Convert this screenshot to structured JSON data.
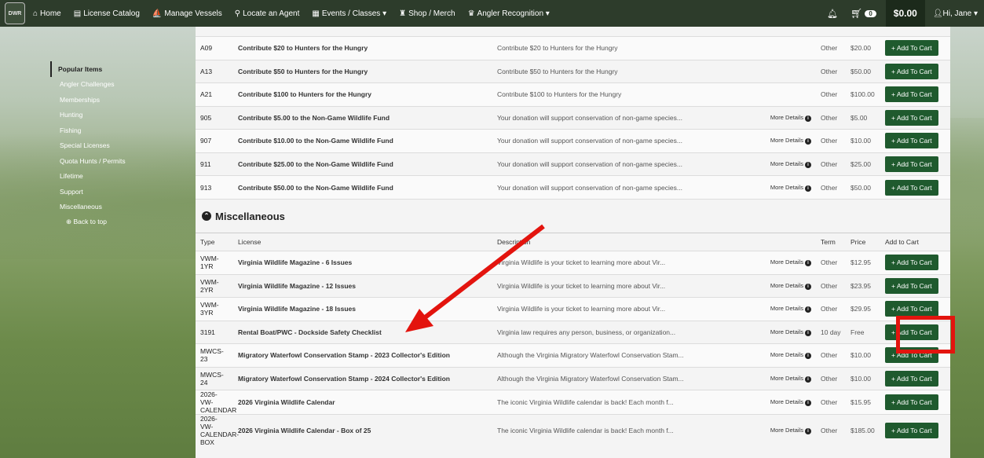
{
  "nav": {
    "logo": "DWR",
    "items": [
      {
        "icon": "home-icon",
        "glyph": "⌂",
        "label": "Home"
      },
      {
        "icon": "catalog-icon",
        "glyph": "▤",
        "label": "License Catalog"
      },
      {
        "icon": "vessel-icon",
        "glyph": "⛵",
        "label": "Manage Vessels"
      },
      {
        "icon": "map-pin-icon",
        "glyph": "⚲",
        "label": "Locate an Agent"
      },
      {
        "icon": "calendar-icon",
        "glyph": "▦",
        "label": "Events / Classes ▾"
      },
      {
        "icon": "shop-icon",
        "glyph": "♜",
        "label": "Shop / Merch"
      },
      {
        "icon": "trophy-icon",
        "glyph": "♛",
        "label": "Angler Recognition ▾"
      }
    ],
    "cart_count": "0",
    "cart_total": "$0.00",
    "user": "Hi, Jane ▾"
  },
  "sidebar": {
    "items": [
      "Popular Items",
      "Angler Challenges",
      "Memberships",
      "Hunting",
      "Fishing",
      "Special Licenses",
      "Quota Hunts / Permits",
      "Lifetime",
      "Support",
      "Miscellaneous"
    ],
    "back": "⊕ Back to top"
  },
  "support_rows": [
    {
      "type": "A09",
      "name": "Contribute $20 to Hunters for the Hungry",
      "desc": "Contribute $20 to Hunters for the Hungry",
      "more": "",
      "term": "Other",
      "price": "$20.00"
    },
    {
      "type": "A13",
      "name": "Contribute $50 to Hunters for the Hungry",
      "desc": "Contribute $50 to Hunters for the Hungry",
      "more": "",
      "term": "Other",
      "price": "$50.00"
    },
    {
      "type": "A21",
      "name": "Contribute $100 to Hunters for the Hungry",
      "desc": "Contribute $100 to Hunters for the Hungry",
      "more": "",
      "term": "Other",
      "price": "$100.00"
    },
    {
      "type": "905",
      "name": "Contribute $5.00 to the Non-Game Wildlife Fund",
      "desc": "Your donation will support conservation of non-game species...",
      "more": "More Details",
      "term": "Other",
      "price": "$5.00"
    },
    {
      "type": "907",
      "name": "Contribute $10.00 to the Non-Game Wildlife Fund",
      "desc": "Your donation will support conservation of non-game species...",
      "more": "More Details",
      "term": "Other",
      "price": "$10.00"
    },
    {
      "type": "911",
      "name": "Contribute $25.00 to the Non-Game Wildlife Fund",
      "desc": "Your donation will support conservation of non-game species...",
      "more": "More Details",
      "term": "Other",
      "price": "$25.00"
    },
    {
      "type": "913",
      "name": "Contribute $50.00 to the Non-Game Wildlife Fund",
      "desc": "Your donation will support conservation of non-game species...",
      "more": "More Details",
      "term": "Other",
      "price": "$50.00"
    }
  ],
  "misc": {
    "title": "Miscellaneous",
    "headers": {
      "type": "Type",
      "license": "License",
      "desc": "Description",
      "term": "Term",
      "price": "Price",
      "cart": "Add to Cart"
    },
    "rows": [
      {
        "type": "VWM-1YR",
        "name": "Virginia Wildlife Magazine - 6 Issues",
        "desc": "Virginia Wildlife is your ticket to learning more about Vir...",
        "more": "More Details",
        "term": "Other",
        "price": "$12.95"
      },
      {
        "type": "VWM-2YR",
        "name": "Virginia Wildlife Magazine - 12 Issues",
        "desc": "Virginia Wildlife is your ticket to learning more about Vir...",
        "more": "More Details",
        "term": "Other",
        "price": "$23.95"
      },
      {
        "type": "VWM-3YR",
        "name": "Virginia Wildlife Magazine - 18 Issues",
        "desc": "Virginia Wildlife is your ticket to learning more about Vir...",
        "more": "More Details",
        "term": "Other",
        "price": "$29.95"
      },
      {
        "type": "3191",
        "name": "Rental Boat/PWC - Dockside Safety Checklist",
        "desc": "Virginia law requires any person, business, or organization...",
        "more": "More Details",
        "term": "10 day",
        "price": "Free"
      },
      {
        "type": "MWCS-23",
        "name": "Migratory Waterfowl Conservation Stamp - 2023 Collector's Edition",
        "desc": "Although the Virginia Migratory Waterfowl Conservation Stam...",
        "more": "More Details",
        "term": "Other",
        "price": "$10.00"
      },
      {
        "type": "MWCS-24",
        "name": "Migratory Waterfowl Conservation Stamp - 2024 Collector's Edition",
        "desc": "Although the Virginia Migratory Waterfowl Conservation Stam...",
        "more": "More Details",
        "term": "Other",
        "price": "$10.00"
      },
      {
        "type": "2026-VW-CALENDAR",
        "name": "2026 Virginia Wildlife Calendar",
        "desc": "The iconic Virginia Wildlife calendar is back! Each month f...",
        "more": "More Details",
        "term": "Other",
        "price": "$15.95"
      },
      {
        "type": "2026-VW-CALENDAR-BOX",
        "name": "2026 Virginia Wildlife Calendar - Box of 25",
        "desc": "The iconic Virginia Wildlife calendar is back! Each month f...",
        "more": "More Details",
        "term": "Other",
        "price": "$185.00"
      }
    ]
  },
  "add_label": "+ Add To Cart",
  "colors": {
    "nav": "#2d3c2b",
    "button": "#1f5a2e",
    "highlight": "#e3140e"
  }
}
